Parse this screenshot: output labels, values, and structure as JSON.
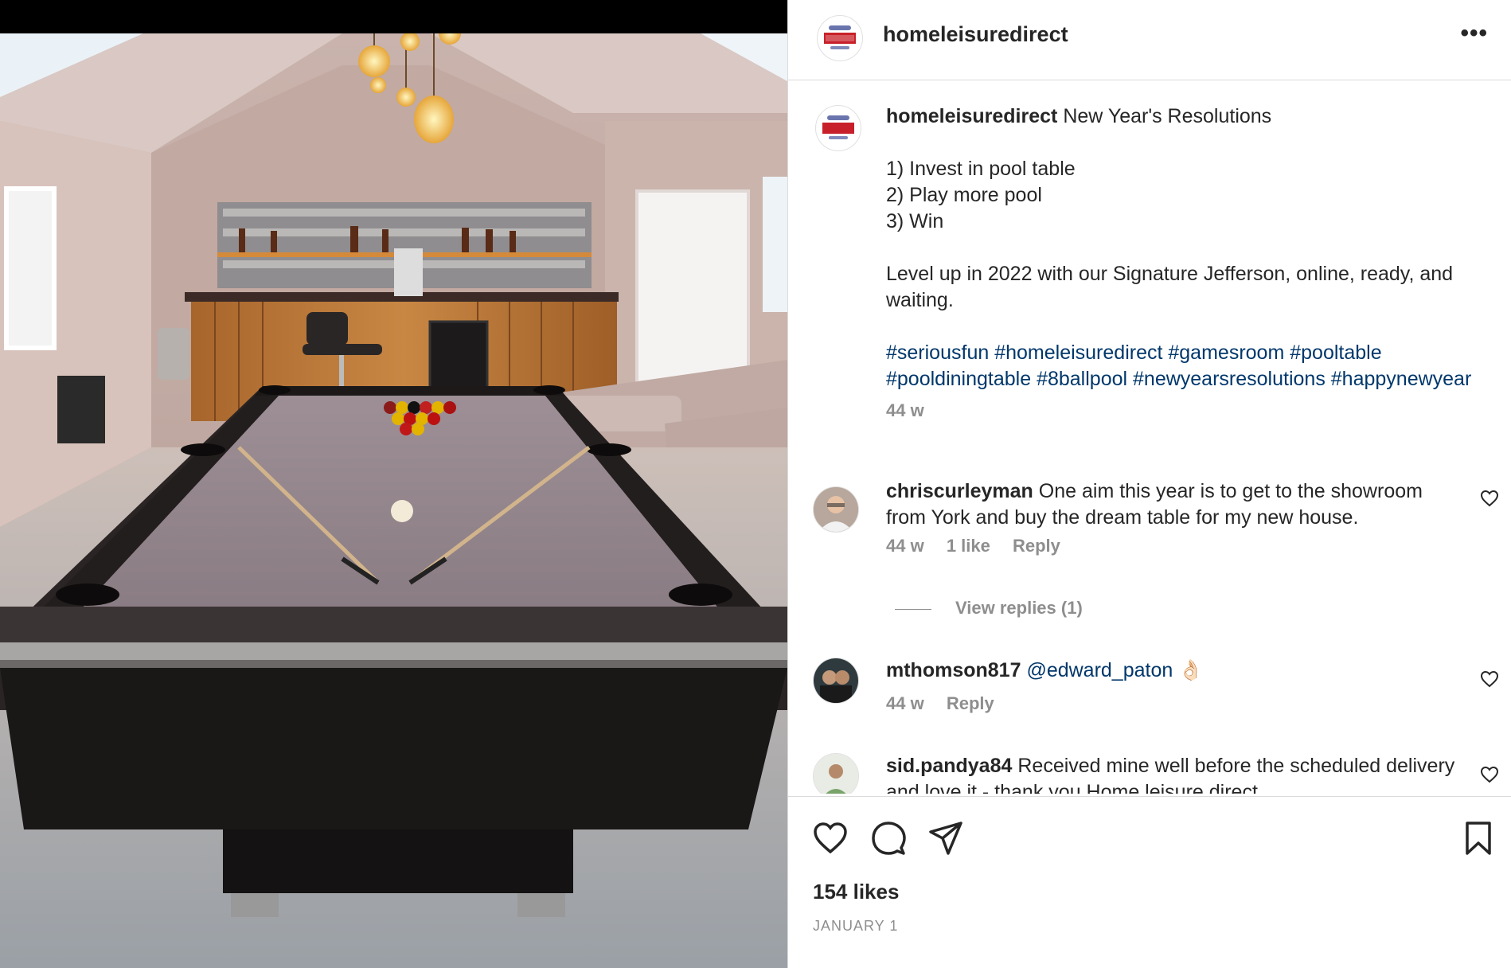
{
  "post": {
    "username": "homeleisuredirect",
    "more_icon": "more-dots-icon",
    "caption": {
      "headline": "New Year's Resolutions",
      "resolutions": [
        "1) Invest in pool table",
        "2) Play more pool",
        "3) Win"
      ],
      "body": "Level up in 2022 with our Signature Jefferson, online, ready, and waiting.",
      "hashtags": [
        "#seriousfun",
        "#homeleisuredirect",
        "#gamesroom",
        "#pooltable",
        "#pooldiningtable",
        "#8ballpool",
        "#newyearsresolutions",
        "#happynewyear"
      ],
      "time": "44 w"
    },
    "comments": [
      {
        "username": "chriscurleyman",
        "text": "One aim this year is to get to the showroom from York and buy the dream table for my new house.",
        "time": "44 w",
        "likes": "1 like",
        "reply": "Reply",
        "view_replies": "View replies (1)"
      },
      {
        "username": "mthomson817",
        "mention": "@edward_paton",
        "emoji": "👌🏻",
        "time": "44 w",
        "reply": "Reply"
      },
      {
        "username": "sid.pandya84",
        "text": "Received mine well before the scheduled delivery and love it - thank you Home leisure direct"
      }
    ],
    "likes": "154 likes",
    "date": "JANUARY 1"
  },
  "colors": {
    "link": "#00376b",
    "muted": "#8e8e8e",
    "border": "#dbdbdb"
  }
}
